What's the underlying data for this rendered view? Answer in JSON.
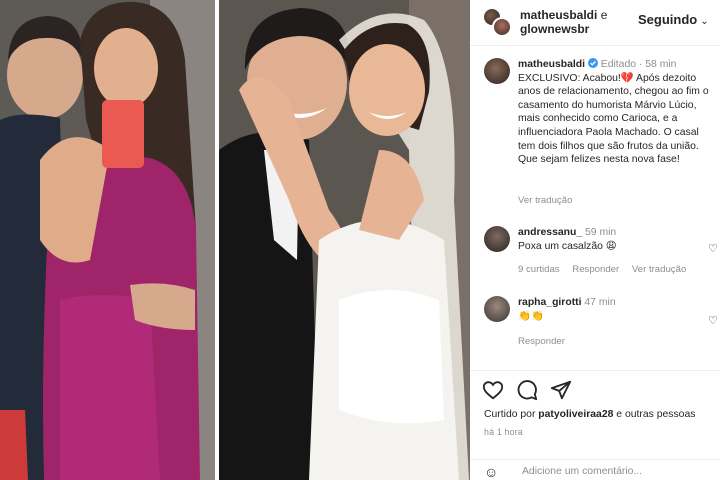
{
  "header": {
    "user1": "matheusbaldi",
    "connector": "e",
    "user2": "glownewsbr",
    "follow_label": "Seguindo",
    "follow_chevron": "⌄"
  },
  "caption": {
    "user": "matheusbaldi",
    "edited": "Editado",
    "age": "58 min",
    "text": "EXCLUSIVO: Acabou!💔 Após dezoito anos de relacionamento, chegou ao fim o casamento do humorista Márvio Lúcio, mais conhecido como Carioca, e a influenciadora Paola Machado. O casal tem dois filhos que são frutos da união. Que sejam felizes nesta nova fase!",
    "translate": "Ver tradução"
  },
  "comments": [
    {
      "user": "andressanu_",
      "age": "59 min",
      "text": "Poxa um casalzão 😩",
      "likes": "9 curtidas",
      "reply": "Responder",
      "translate": "Ver tradução"
    },
    {
      "user": "rapha_girotti",
      "age": "47 min",
      "text": "👏👏",
      "reply": "Responder"
    }
  ],
  "actions": {
    "like_icon": "heart-outline",
    "comment_icon": "speech-bubble",
    "share_icon": "paper-plane"
  },
  "likes": {
    "prefix": "Curtido por",
    "user": "patyoliveiraa28",
    "suffix": "e outras pessoas"
  },
  "post_time": "há 1 hora",
  "comment_input": {
    "placeholder": "Adicione um comentário..."
  },
  "colors": {
    "text": "#262626",
    "muted": "#8e8e8e",
    "verified": "#3897f0",
    "border": "#efefef"
  }
}
